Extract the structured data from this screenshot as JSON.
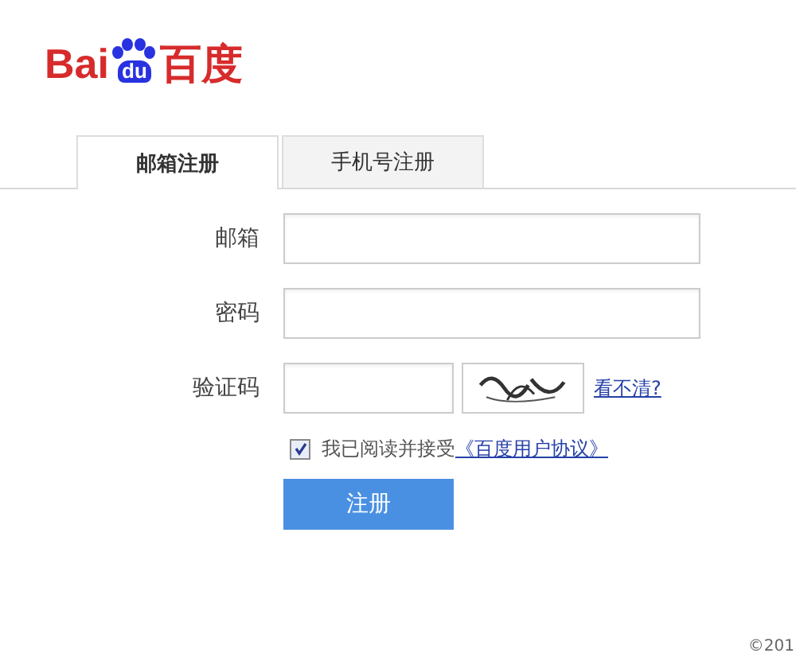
{
  "logo": {
    "left": "Bai",
    "paw": "du",
    "right": "百度"
  },
  "tabs": [
    {
      "label": "邮箱注册",
      "selected": true
    },
    {
      "label": "手机号注册",
      "selected": false
    }
  ],
  "fields": [
    {
      "label": "邮箱",
      "kind": "text"
    },
    {
      "label": "密码",
      "kind": "text"
    },
    {
      "label": "验证码",
      "kind": "captcha",
      "refresh_link": "看不清?"
    }
  ],
  "agreement": {
    "checked": true,
    "text": "我已阅读并接受",
    "link": "《百度用户协议》"
  },
  "submit": "注册",
  "footer": "©201"
}
